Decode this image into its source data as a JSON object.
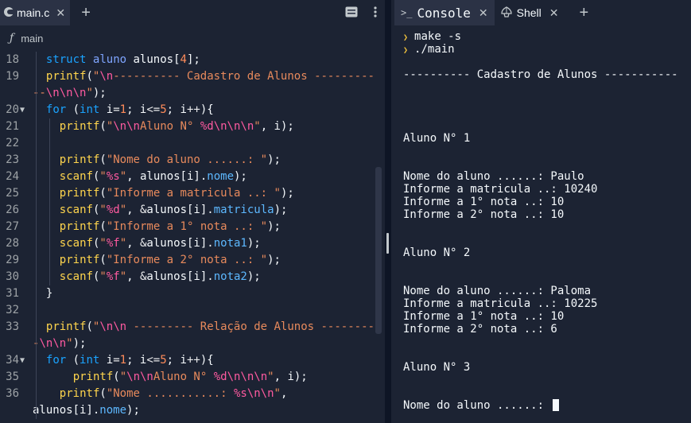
{
  "editor": {
    "tabs": [
      {
        "label": "main.c",
        "active": true
      }
    ],
    "breadcrumb": {
      "symbol": "ƒ",
      "name": "main"
    },
    "lines": [
      {
        "n": "18",
        "fold": "",
        "indent": 1,
        "tokens": [
          [
            "struct",
            "kw"
          ],
          [
            " ",
            ""
          ],
          [
            "aluno",
            "ty"
          ],
          [
            " alunos[",
            ""
          ],
          [
            "4",
            "num"
          ],
          [
            "];",
            ""
          ]
        ]
      },
      {
        "n": "19",
        "fold": "",
        "indent": 1,
        "tokens": [
          [
            "printf",
            "fnc"
          ],
          [
            "(",
            ""
          ],
          [
            "\"",
            "str"
          ],
          [
            "\\n",
            "esc"
          ],
          [
            "---------- Cadastro de Alunos ---------",
            "str"
          ]
        ]
      },
      {
        "n": "",
        "fold": "",
        "indent": 0,
        "tokens": [
          [
            "--",
            "str"
          ],
          [
            "\\n\\n\\n",
            "esc"
          ],
          [
            "\"",
            "str"
          ],
          [
            ");",
            ""
          ]
        ]
      },
      {
        "n": "20",
        "fold": "▼",
        "indent": 1,
        "tokens": [
          [
            "for",
            "kw"
          ],
          [
            " (",
            ""
          ],
          [
            "int",
            "kw"
          ],
          [
            " i",
            ""
          ],
          [
            "=",
            "op"
          ],
          [
            "1",
            "num"
          ],
          [
            "; i",
            ""
          ],
          [
            "<=",
            "op"
          ],
          [
            "5",
            "num"
          ],
          [
            "; i",
            ""
          ],
          [
            "++",
            "op"
          ],
          [
            "){",
            ""
          ]
        ]
      },
      {
        "n": "21",
        "fold": "",
        "indent": 2,
        "tokens": [
          [
            "printf",
            "fnc"
          ],
          [
            "(",
            ""
          ],
          [
            "\"",
            "str"
          ],
          [
            "\\n\\n",
            "esc"
          ],
          [
            "Aluno N° ",
            "str"
          ],
          [
            "%d",
            "esc"
          ],
          [
            "\\n\\n\\n",
            "esc"
          ],
          [
            "\"",
            "str"
          ],
          [
            ", i);",
            ""
          ]
        ]
      },
      {
        "n": "22",
        "fold": "",
        "indent": 2,
        "tokens": []
      },
      {
        "n": "23",
        "fold": "",
        "indent": 2,
        "tokens": [
          [
            "printf",
            "fnc"
          ],
          [
            "(",
            ""
          ],
          [
            "\"Nome do aluno ......: \"",
            "str"
          ],
          [
            ");",
            ""
          ]
        ]
      },
      {
        "n": "24",
        "fold": "",
        "indent": 2,
        "tokens": [
          [
            "scanf",
            "fnc"
          ],
          [
            "(",
            ""
          ],
          [
            "\"",
            "str"
          ],
          [
            "%s",
            "esc"
          ],
          [
            "\"",
            "str"
          ],
          [
            ", alunos[i].",
            ""
          ],
          [
            "nome",
            "mem"
          ],
          [
            ");",
            ""
          ]
        ]
      },
      {
        "n": "25",
        "fold": "",
        "indent": 2,
        "tokens": [
          [
            "printf",
            "fnc"
          ],
          [
            "(",
            ""
          ],
          [
            "\"Informe a matricula ..: \"",
            "str"
          ],
          [
            ");",
            ""
          ]
        ]
      },
      {
        "n": "26",
        "fold": "",
        "indent": 2,
        "tokens": [
          [
            "scanf",
            "fnc"
          ],
          [
            "(",
            ""
          ],
          [
            "\"",
            "str"
          ],
          [
            "%d",
            "esc"
          ],
          [
            "\"",
            "str"
          ],
          [
            ", ",
            ""
          ],
          [
            "&",
            "op"
          ],
          [
            "alunos[i].",
            ""
          ],
          [
            "matricula",
            "mem"
          ],
          [
            ");",
            ""
          ]
        ]
      },
      {
        "n": "27",
        "fold": "",
        "indent": 2,
        "tokens": [
          [
            "printf",
            "fnc"
          ],
          [
            "(",
            ""
          ],
          [
            "\"Informe a 1° nota ..: \"",
            "str"
          ],
          [
            ");",
            ""
          ]
        ]
      },
      {
        "n": "28",
        "fold": "",
        "indent": 2,
        "tokens": [
          [
            "scanf",
            "fnc"
          ],
          [
            "(",
            ""
          ],
          [
            "\"",
            "str"
          ],
          [
            "%f",
            "esc"
          ],
          [
            "\"",
            "str"
          ],
          [
            ", ",
            ""
          ],
          [
            "&",
            "op"
          ],
          [
            "alunos[i].",
            ""
          ],
          [
            "nota1",
            "mem"
          ],
          [
            ");",
            ""
          ]
        ]
      },
      {
        "n": "29",
        "fold": "",
        "indent": 2,
        "tokens": [
          [
            "printf",
            "fnc"
          ],
          [
            "(",
            ""
          ],
          [
            "\"Informe a 2° nota ..: \"",
            "str"
          ],
          [
            ");",
            ""
          ]
        ]
      },
      {
        "n": "30",
        "fold": "",
        "indent": 2,
        "tokens": [
          [
            "scanf",
            "fnc"
          ],
          [
            "(",
            ""
          ],
          [
            "\"",
            "str"
          ],
          [
            "%f",
            "esc"
          ],
          [
            "\"",
            "str"
          ],
          [
            ", ",
            ""
          ],
          [
            "&",
            "op"
          ],
          [
            "alunos[i].",
            ""
          ],
          [
            "nota2",
            "mem"
          ],
          [
            ");",
            ""
          ]
        ]
      },
      {
        "n": "31",
        "fold": "",
        "indent": 1,
        "tokens": [
          [
            "}",
            ""
          ]
        ]
      },
      {
        "n": "32",
        "fold": "",
        "indent": 1,
        "tokens": []
      },
      {
        "n": "33",
        "fold": "",
        "indent": 1,
        "tokens": [
          [
            "printf",
            "fnc"
          ],
          [
            "(",
            ""
          ],
          [
            "\"",
            "str"
          ],
          [
            "\\n\\n",
            "esc"
          ],
          [
            " --------- Relação de Alunos --------",
            "str"
          ]
        ]
      },
      {
        "n": "",
        "fold": "",
        "indent": 0,
        "tokens": [
          [
            "-",
            "str"
          ],
          [
            "\\n\\n",
            "esc"
          ],
          [
            "\"",
            "str"
          ],
          [
            ");",
            ""
          ]
        ]
      },
      {
        "n": "34",
        "fold": "▼",
        "indent": 1,
        "tokens": [
          [
            "for",
            "kw"
          ],
          [
            " (",
            ""
          ],
          [
            "int",
            "kw"
          ],
          [
            " i",
            ""
          ],
          [
            "=",
            "op"
          ],
          [
            "1",
            "num"
          ],
          [
            "; i",
            ""
          ],
          [
            "<=",
            "op"
          ],
          [
            "5",
            "num"
          ],
          [
            "; i",
            ""
          ],
          [
            "++",
            "op"
          ],
          [
            "){",
            ""
          ]
        ]
      },
      {
        "n": "35",
        "fold": "",
        "indent": 3,
        "tokens": [
          [
            "printf",
            "fnc"
          ],
          [
            "(",
            ""
          ],
          [
            "\"",
            "str"
          ],
          [
            "\\n\\n",
            "esc"
          ],
          [
            "Aluno N° ",
            "str"
          ],
          [
            "%d",
            "esc"
          ],
          [
            "\\n\\n\\n",
            "esc"
          ],
          [
            "\"",
            "str"
          ],
          [
            ", i);",
            ""
          ]
        ]
      },
      {
        "n": "36",
        "fold": "",
        "indent": 2,
        "tokens": [
          [
            "printf",
            "fnc"
          ],
          [
            "(",
            ""
          ],
          [
            "\"Nome ...........: ",
            "str"
          ],
          [
            "%s",
            "esc"
          ],
          [
            "\\n\\n",
            "esc"
          ],
          [
            "\"",
            "str"
          ],
          [
            ",",
            ""
          ]
        ]
      },
      {
        "n": "",
        "fold": "",
        "indent": 0,
        "tokens": [
          [
            "alunos[i].",
            ""
          ],
          [
            "nome",
            "mem"
          ],
          [
            ");",
            ""
          ]
        ]
      }
    ]
  },
  "console": {
    "tabs": [
      {
        "label": "Console",
        "active": true
      },
      {
        "label": "Shell",
        "active": false
      }
    ],
    "commands": [
      "make -s",
      "./main"
    ],
    "output": [
      {
        "text": "---------- Cadastro de Alunos -----------",
        "row": 0
      },
      {
        "text": "Aluno N° 1",
        "row": 5
      },
      {
        "text": "Nome do aluno ......: Paulo",
        "row": 8
      },
      {
        "text": "Informe a matricula ..: 10240",
        "row": 9
      },
      {
        "text": "Informe a 1° nota ..: 10",
        "row": 10
      },
      {
        "text": "Informe a 2° nota ..: 10",
        "row": 11
      },
      {
        "text": "Aluno N° 2",
        "row": 14
      },
      {
        "text": "Nome do aluno ......: Paloma",
        "row": 17
      },
      {
        "text": "Informe a matricula ..: 10225",
        "row": 18
      },
      {
        "text": "Informe a 1° nota ..: 10",
        "row": 19
      },
      {
        "text": "Informe a 2° nota ..: 6",
        "row": 20
      },
      {
        "text": "Aluno N° 3",
        "row": 23
      }
    ],
    "input_line": "Nome do aluno ......: "
  },
  "colors": {
    "background": "#1c2333",
    "tab_active": "#2b3245",
    "keyword": "#1aa3ff",
    "function": "#ffd54d",
    "string": "#e88a5c",
    "escape": "#ff5aa0",
    "member": "#5db8ff",
    "prompt": "#f0c23c"
  },
  "icons": [
    "c-language-icon",
    "close-icon",
    "plus-icon",
    "keyboard-icon",
    "more-vertical-icon",
    "function-icon",
    "terminal-icon",
    "shell-icon"
  ]
}
